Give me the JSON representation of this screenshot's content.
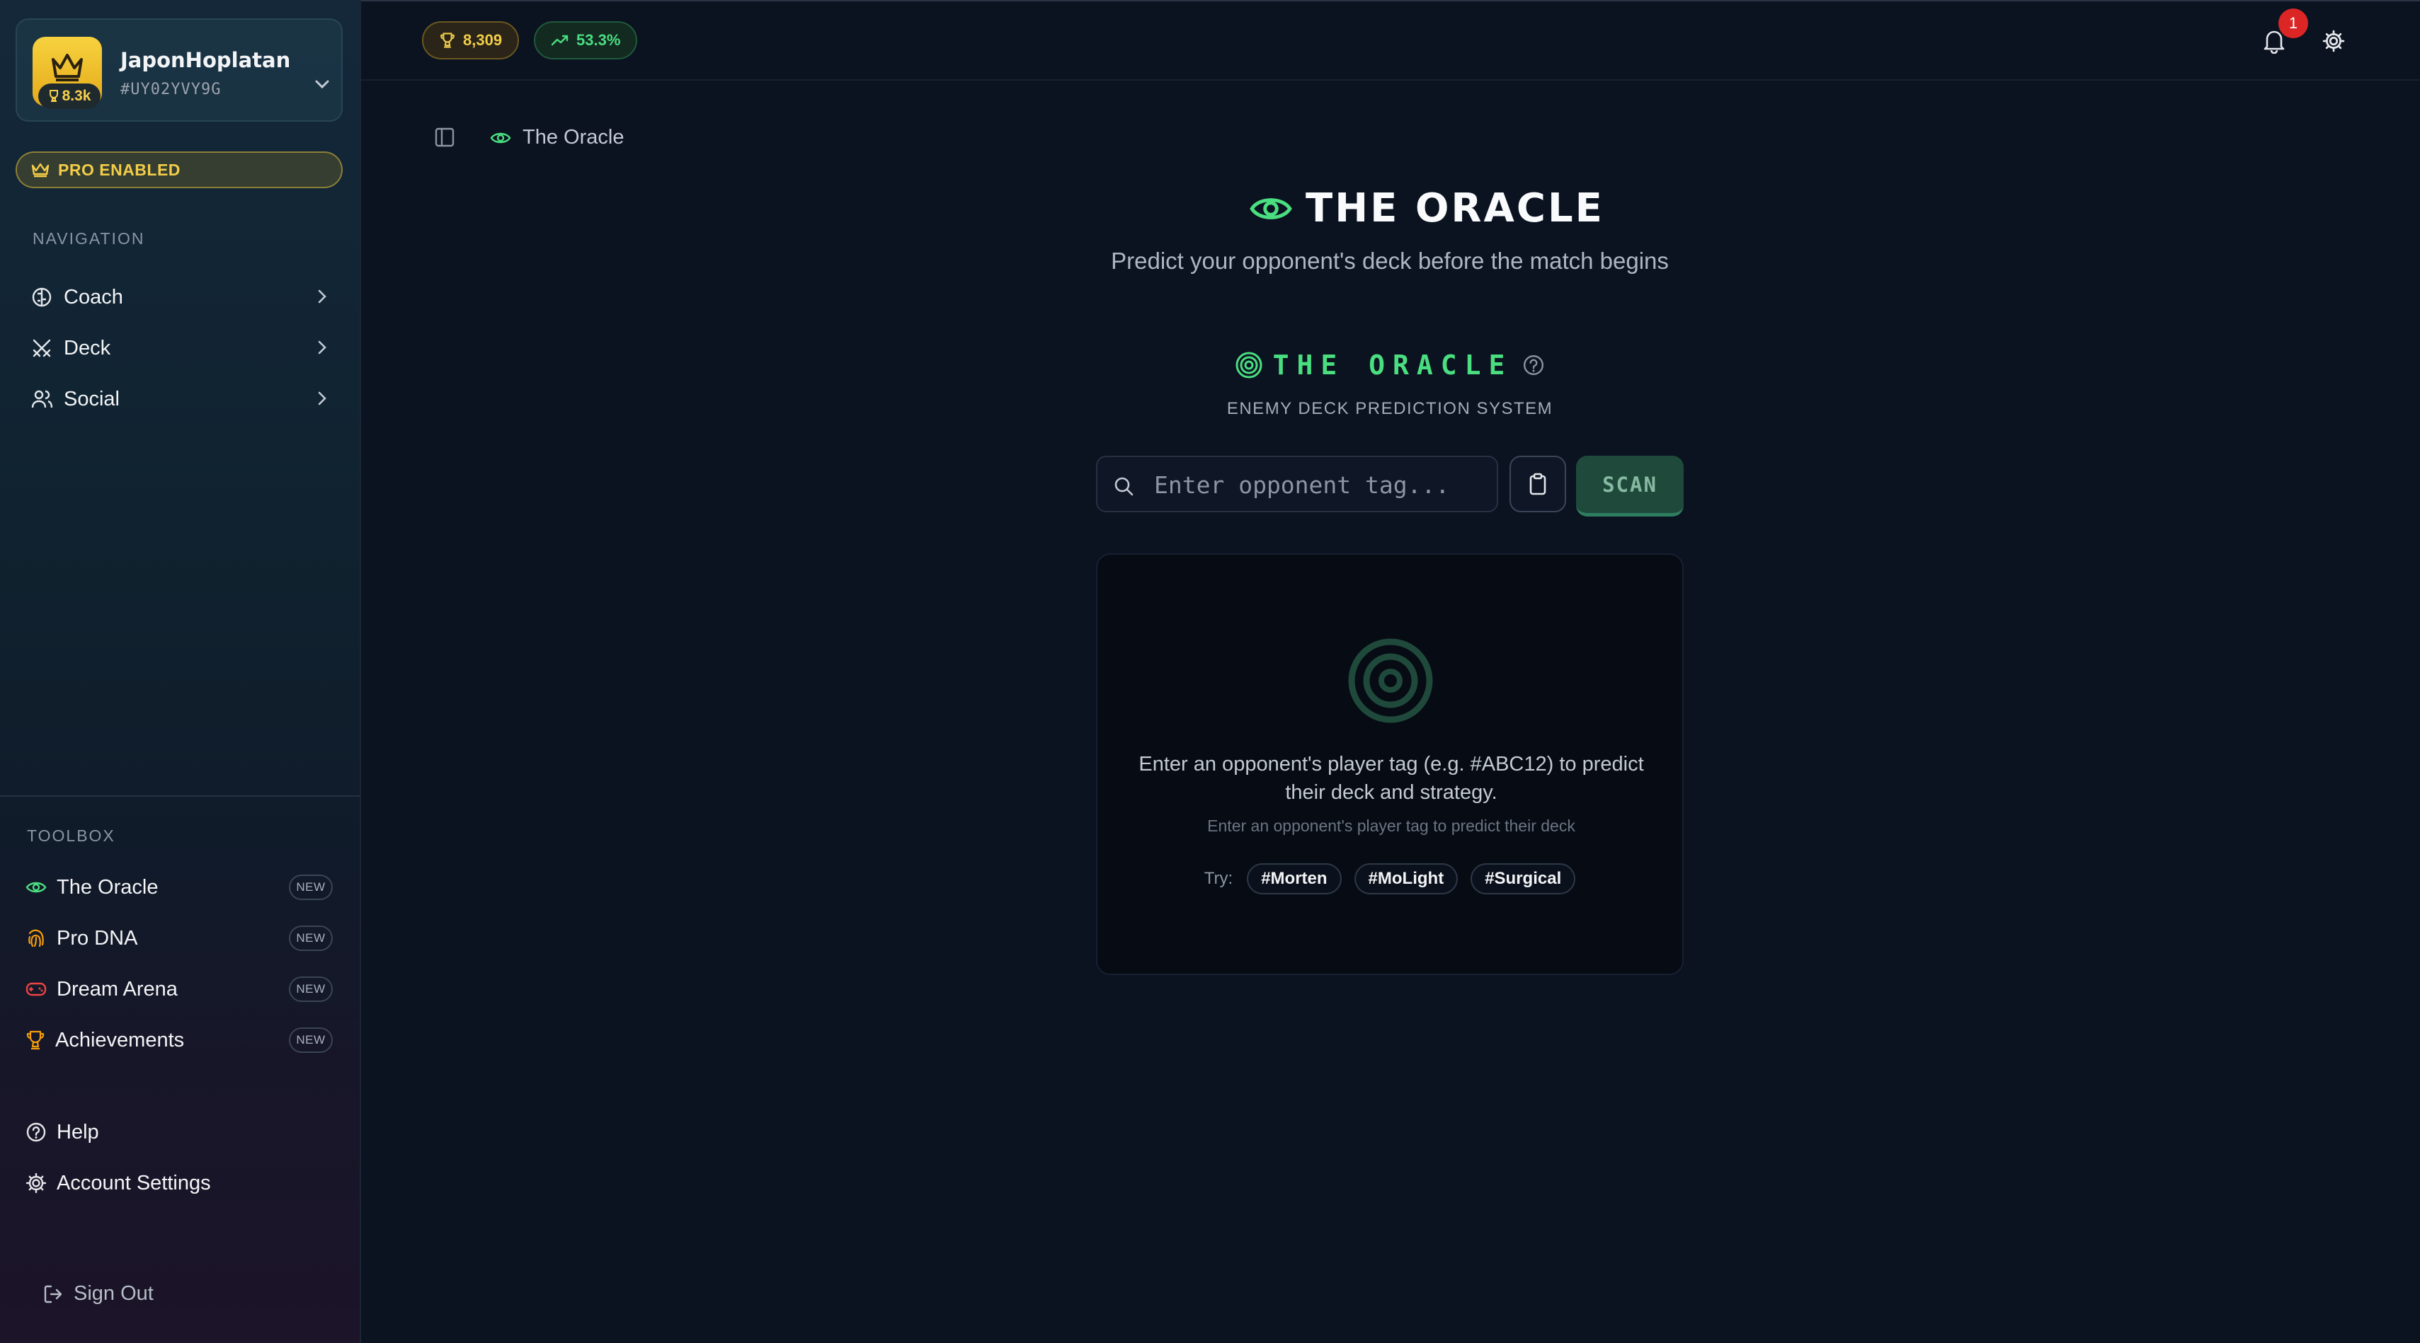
{
  "profile": {
    "name": "JaponHoplatan",
    "tag": "#UY02YVY9G",
    "trophies_short": "8.3k"
  },
  "pro_badge": "PRO ENABLED",
  "navigation": {
    "label": "NAVIGATION",
    "items": [
      {
        "label": "Coach",
        "icon": "brain-icon"
      },
      {
        "label": "Deck",
        "icon": "swords-icon"
      },
      {
        "label": "Social",
        "icon": "users-icon"
      }
    ]
  },
  "toolbox": {
    "label": "TOOLBOX",
    "new_label": "NEW",
    "items": [
      {
        "label": "The Oracle",
        "icon": "eye-icon",
        "color": "#4ade80"
      },
      {
        "label": "Pro DNA",
        "icon": "fingerprint-icon",
        "color": "#f59e0b"
      },
      {
        "label": "Dream Arena",
        "icon": "gamepad-icon",
        "color": "#ef4444"
      },
      {
        "label": "Achievements",
        "icon": "trophy-icon",
        "color": "#f59e0b"
      }
    ]
  },
  "footer_links": {
    "help": "Help",
    "account_settings": "Account Settings",
    "sign_out": "Sign Out"
  },
  "topbar": {
    "trophies": "8,309",
    "win_rate": "53.3%",
    "notification_count": "1"
  },
  "breadcrumb": {
    "current": "The Oracle"
  },
  "main": {
    "title": "THE ORACLE",
    "subtitle": "Predict your opponent's deck before the match begins",
    "oracle_heading": "THE ORACLE",
    "oracle_subheading": "ENEMY DECK PREDICTION SYSTEM",
    "search_placeholder": "Enter opponent tag...",
    "scan_label": "SCAN",
    "empty_message": "Enter an opponent's player tag (e.g. #ABC12) to predict their deck and strategy.",
    "empty_hint": "Enter an opponent's player tag to predict their deck",
    "try_label": "Try:",
    "suggestions": [
      "#Morten",
      "#MoLight",
      "#Surgical"
    ]
  },
  "colors": {
    "accent_green": "#4ade80",
    "gold": "#f3cd48",
    "background": "#0b1220"
  }
}
